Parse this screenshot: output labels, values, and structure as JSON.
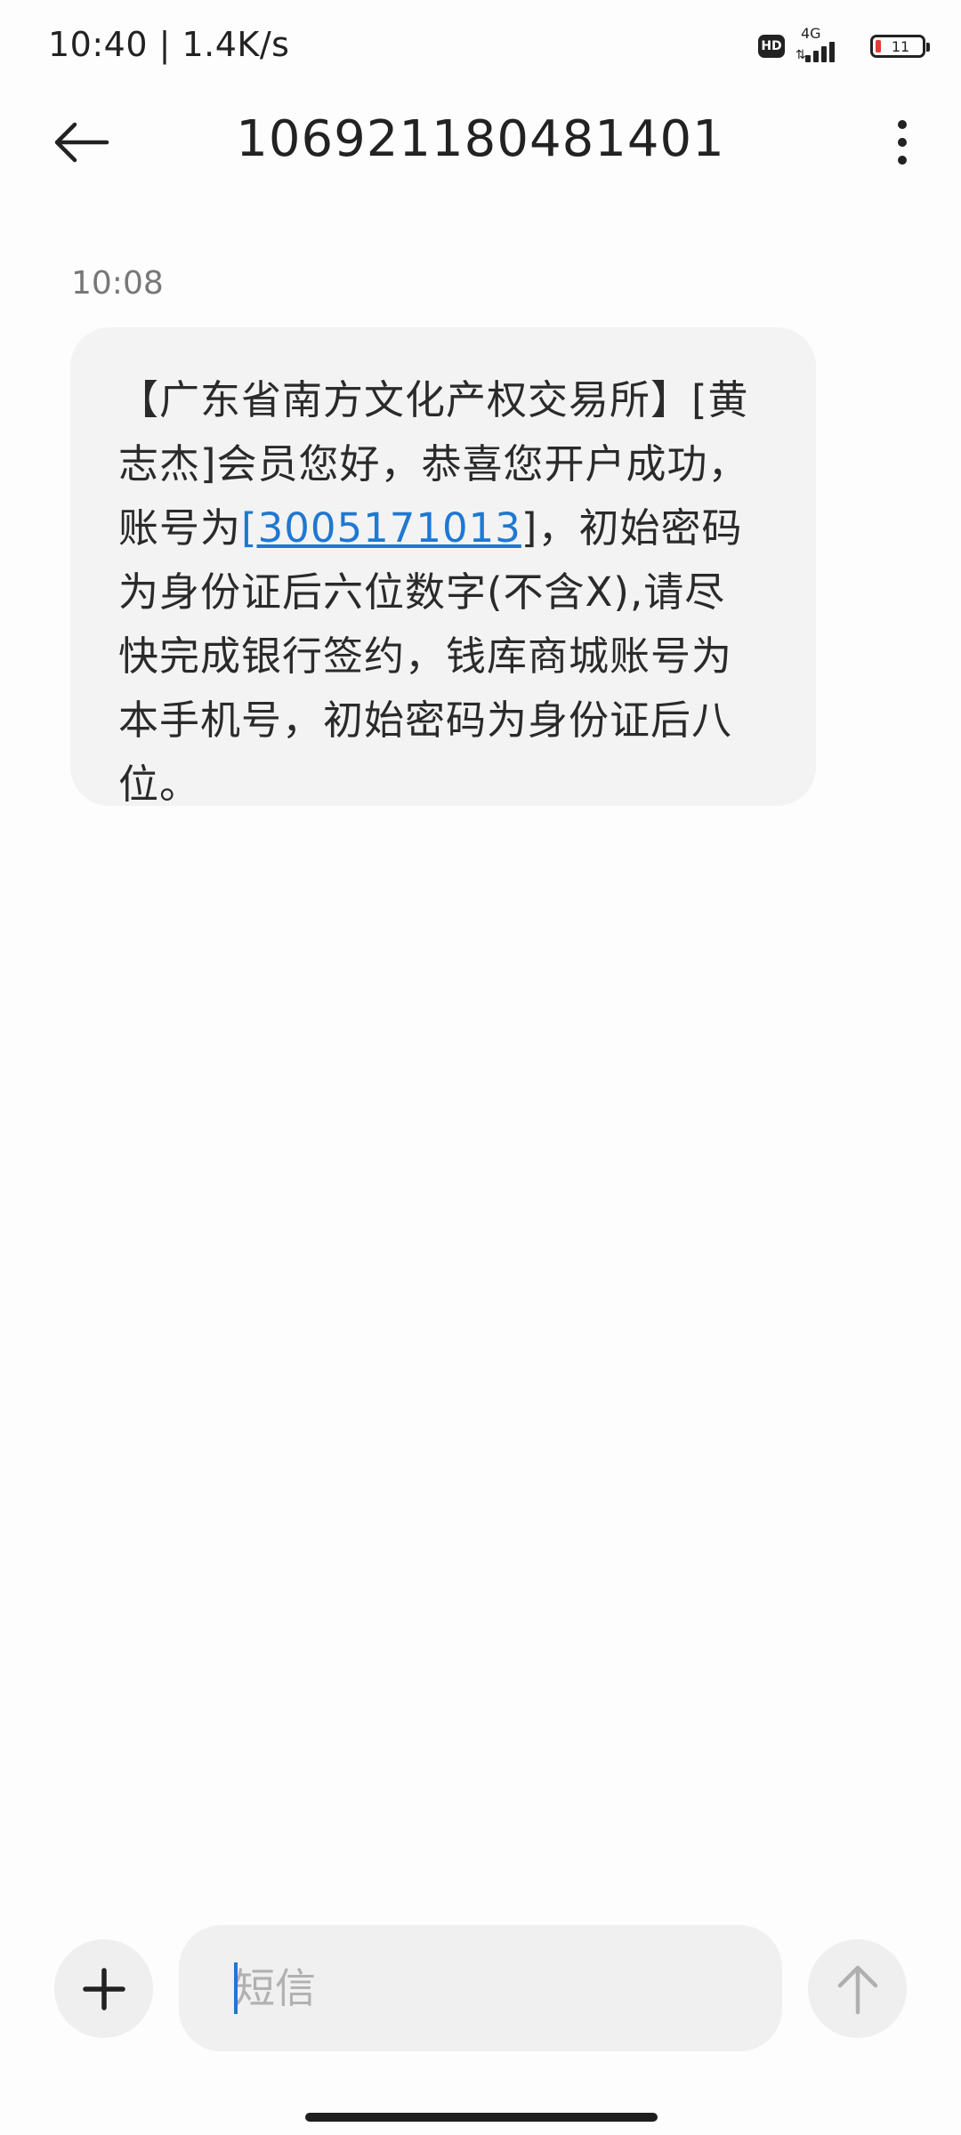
{
  "status_bar": {
    "time_speed": "10:40 | 1.4K/s",
    "hd_badge": "HD",
    "network_type": "4G",
    "battery_level": "11",
    "battery_fraction": 0.11
  },
  "header": {
    "title": "106921180481401",
    "back_icon": "arrow-left-icon",
    "more_icon": "more-vertical-icon"
  },
  "conversation": {
    "messages": [
      {
        "time": "10:08",
        "text_before_link": "【广东省南方文化产权交易所】[黄志杰]会员您好，恭喜您开户成功，账号为",
        "link_text": "[3005171013",
        "text_after_link": "]，初始密码为身份证后六位数字(不含X),请尽快完成银行签约，钱库商城账号为本手机号，初始密码为身份证后八位。"
      }
    ]
  },
  "composer": {
    "placeholder": "短信",
    "value": "",
    "add_icon": "plus-icon",
    "send_icon": "arrow-up-icon"
  },
  "colors": {
    "link": "#1f78d1",
    "bubble_bg": "#f3f3f3",
    "battery_low": "#e53935"
  }
}
